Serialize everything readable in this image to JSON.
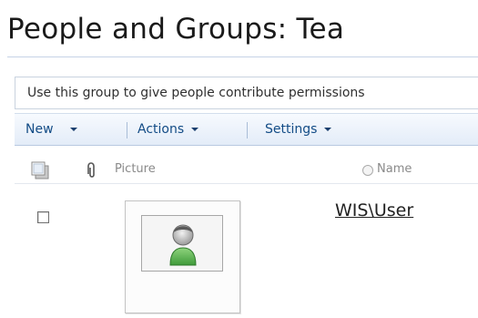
{
  "page": {
    "title": "People and Groups: Tea",
    "description": "Use this group to give people contribute permissions"
  },
  "toolbar": {
    "new_label": "New",
    "actions_label": "Actions",
    "settings_label": "Settings"
  },
  "list": {
    "columns": {
      "select_icon": "select-all-icon",
      "attachment_icon": "paperclip-icon",
      "picture": "Picture",
      "name": "Name"
    },
    "rows": [
      {
        "selected": false,
        "picture_icon": "person-icon",
        "name": "WIS\\User"
      }
    ]
  },
  "colors": {
    "toolbar_text": "#134c86",
    "title_text": "#1a1a1a",
    "header_text": "#8a8a8a"
  }
}
